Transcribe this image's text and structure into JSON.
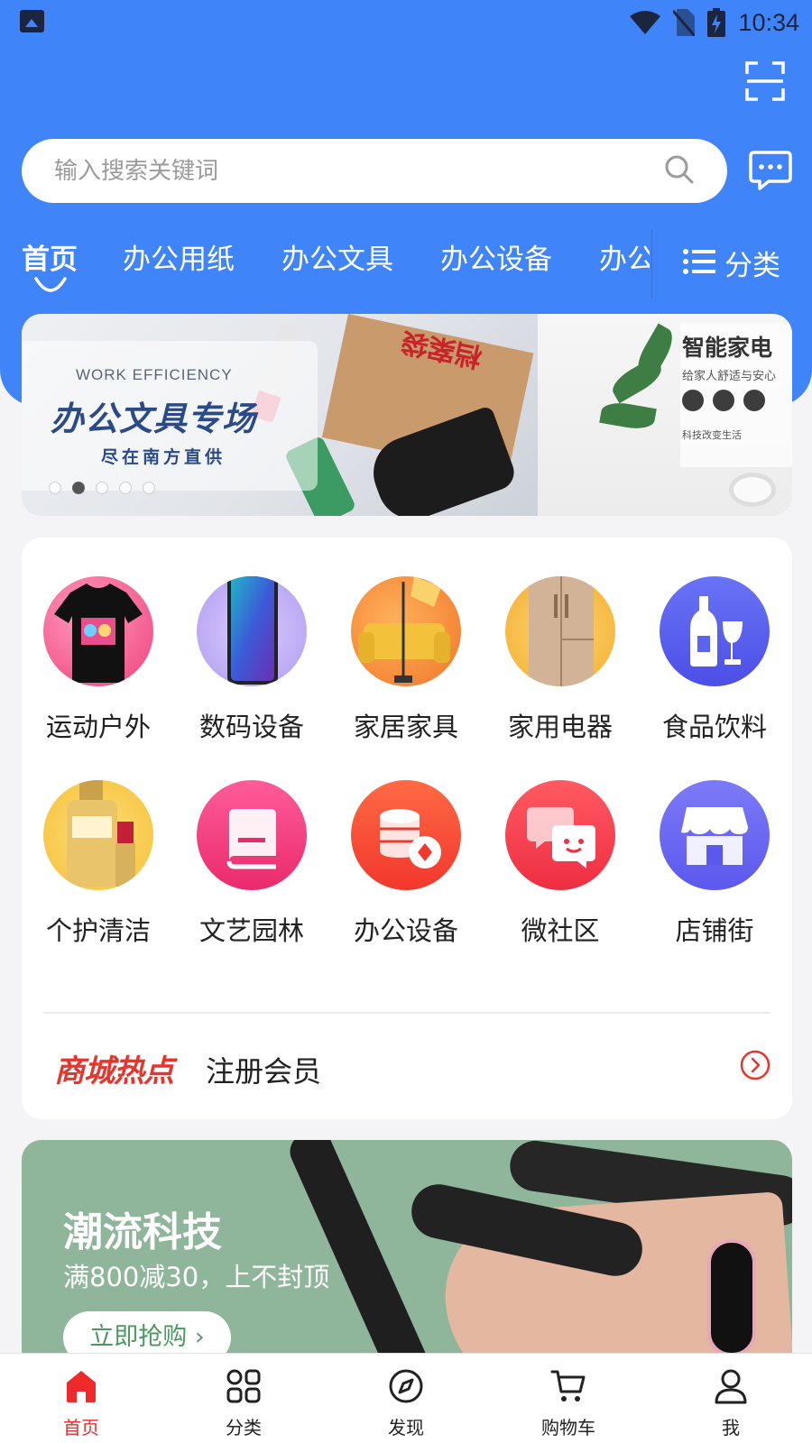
{
  "status_bar": {
    "time": "10:34"
  },
  "search": {
    "placeholder": "输入搜索关键词"
  },
  "nav_tabs": {
    "items": [
      "首页",
      "办公用纸",
      "办公文具",
      "办公设备",
      "办公"
    ],
    "active_index": 0,
    "category_label": "分类"
  },
  "banner": {
    "slide1": {
      "eyebrow": "WORK EFFICIENCY",
      "title": "办公文具专场",
      "subtitle": "尽在南方直供"
    },
    "slide2": {
      "title": "智能家电",
      "subtitle": "给家人舒适与安心",
      "tagline": "科技改变生活"
    },
    "dot_count": 5,
    "active_dot": 1
  },
  "categories": [
    {
      "label": "运动户外",
      "icon": "tshirt-icon",
      "bg": "#f25a8c"
    },
    {
      "label": "数码设备",
      "icon": "smartphone-icon",
      "bg": "#b9a5f5"
    },
    {
      "label": "家居家具",
      "icon": "sofa-lamp-icon",
      "bg": "#f39438"
    },
    {
      "label": "家用电器",
      "icon": "refrigerator-icon",
      "bg": "#f6b73c"
    },
    {
      "label": "食品饮料",
      "icon": "wine-icon",
      "bg": "#5a64f0"
    },
    {
      "label": "个护清洁",
      "icon": "perfume-lipstick-icon",
      "bg": "#f6c640"
    },
    {
      "label": "文艺园林",
      "icon": "book-icon",
      "bg": "#f23a7c"
    },
    {
      "label": "办公设备",
      "icon": "database-icon",
      "bg": "#f84a36"
    },
    {
      "label": "微社区",
      "icon": "chat-bubbles-icon",
      "bg": "#f2404e"
    },
    {
      "label": "店铺街",
      "icon": "storefront-icon",
      "bg": "#6f6cf4"
    }
  ],
  "hot": {
    "logo_text": "商城热点",
    "link_text": "注册会员"
  },
  "promo": {
    "title": "潮流科技",
    "subtitle": "满800减30，上不封顶",
    "button": "立即抢购 ›"
  },
  "bottom_nav": {
    "items": [
      {
        "label": "首页",
        "icon": "home-icon"
      },
      {
        "label": "分类",
        "icon": "grid-icon"
      },
      {
        "label": "发现",
        "icon": "compass-icon"
      },
      {
        "label": "购物车",
        "icon": "cart-icon"
      },
      {
        "label": "我",
        "icon": "user-icon"
      }
    ],
    "active_index": 0
  },
  "colors": {
    "primary": "#3f84f8",
    "accent": "#ee2a2a",
    "promo_bg": "#8fb59a"
  }
}
